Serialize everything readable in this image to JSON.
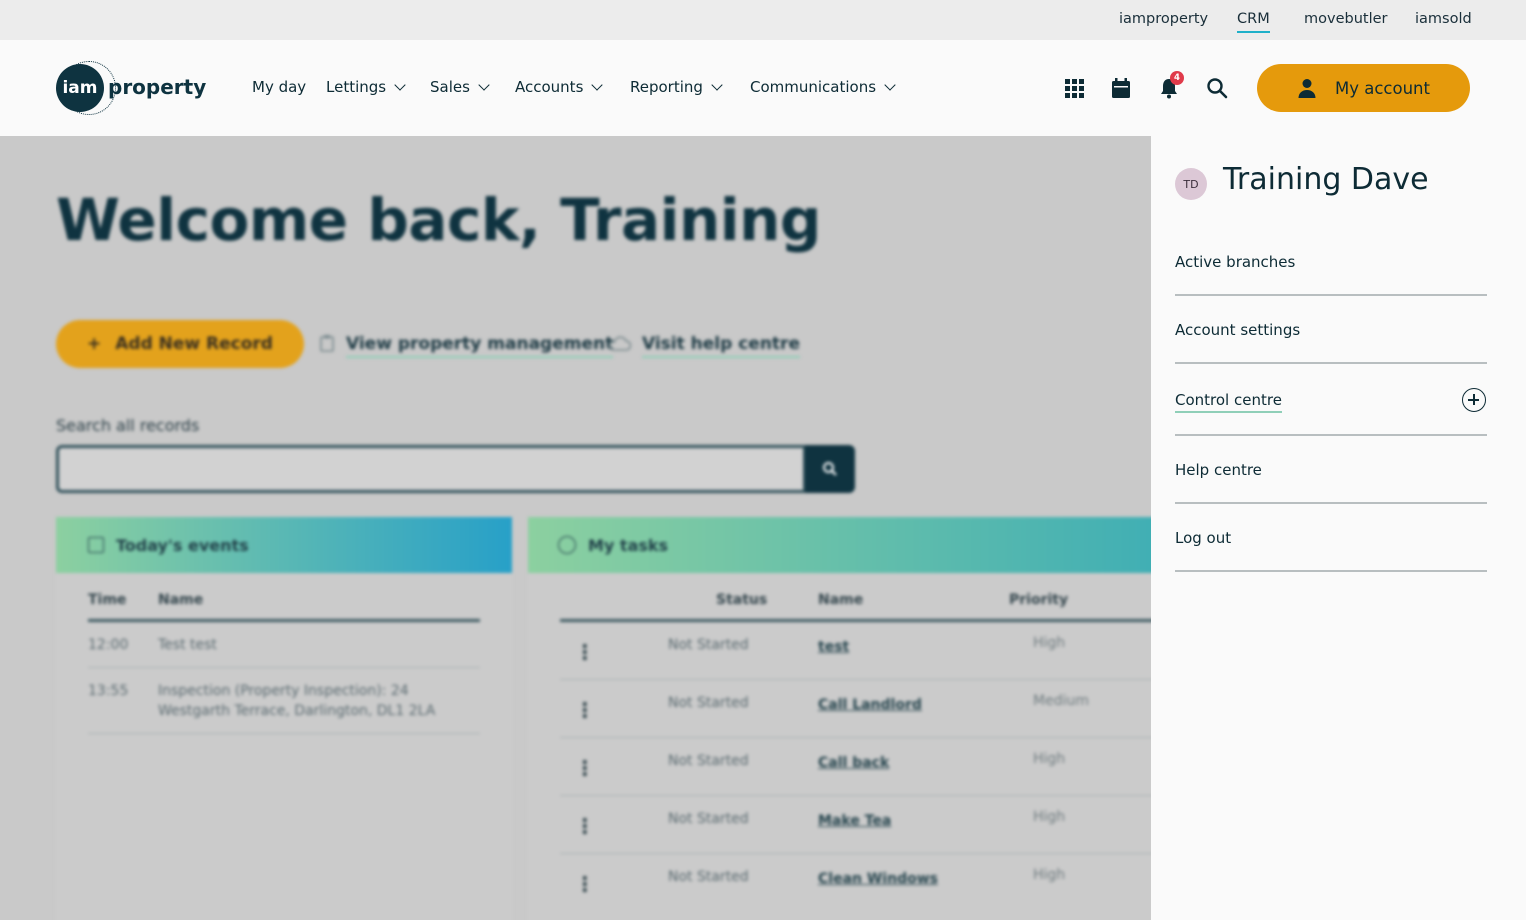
{
  "brand_strip": {
    "links": [
      "iamproperty",
      "CRM",
      "movebutler",
      "iamsold"
    ],
    "active": "CRM"
  },
  "header": {
    "logo": {
      "mark": "iam",
      "word": "property"
    },
    "nav": [
      "My day",
      "Lettings",
      "Sales",
      "Accounts",
      "Reporting",
      "Communications"
    ],
    "icons": [
      "apps-grid-icon",
      "calendar-icon",
      "bell-icon",
      "search-icon"
    ],
    "notification_count": "4",
    "account_button": "My account",
    "accent_color": "#e59a0c"
  },
  "main": {
    "welcome": "Welcome back, Training",
    "add_button": "Add New Record",
    "quick_links": [
      "View property management",
      "Visit help centre"
    ],
    "search_label": "Search all records",
    "search_value": "",
    "events": {
      "title": "Today's events",
      "columns": [
        "Time",
        "Name"
      ],
      "rows": [
        {
          "time": "12:00",
          "name": "Test test"
        },
        {
          "time": "13:55",
          "name_line1": "Inspection (Property Inspection): 24",
          "name_line2": "Westgarth Terrace, Darlington, DL1 2LA"
        }
      ]
    },
    "tasks": {
      "title": "My tasks",
      "columns": [
        "Status",
        "Name",
        "Priority"
      ],
      "rows": [
        {
          "status": "Not Started",
          "name": "test",
          "priority": "High"
        },
        {
          "status": "Not Started",
          "name": "Call Landlord",
          "priority": "Medium"
        },
        {
          "status": "Not Started",
          "name": "Call back",
          "priority": "High"
        },
        {
          "status": "Not Started",
          "name": "Make Tea",
          "priority": "High"
        },
        {
          "status": "Not Started",
          "name": "Clean Windows",
          "priority": "High"
        }
      ]
    }
  },
  "account_panel": {
    "initials": "TD",
    "user_name": "Training Dave",
    "menu": [
      "Active branches",
      "Account settings",
      "Control centre",
      "Help centre",
      "Log out"
    ]
  }
}
